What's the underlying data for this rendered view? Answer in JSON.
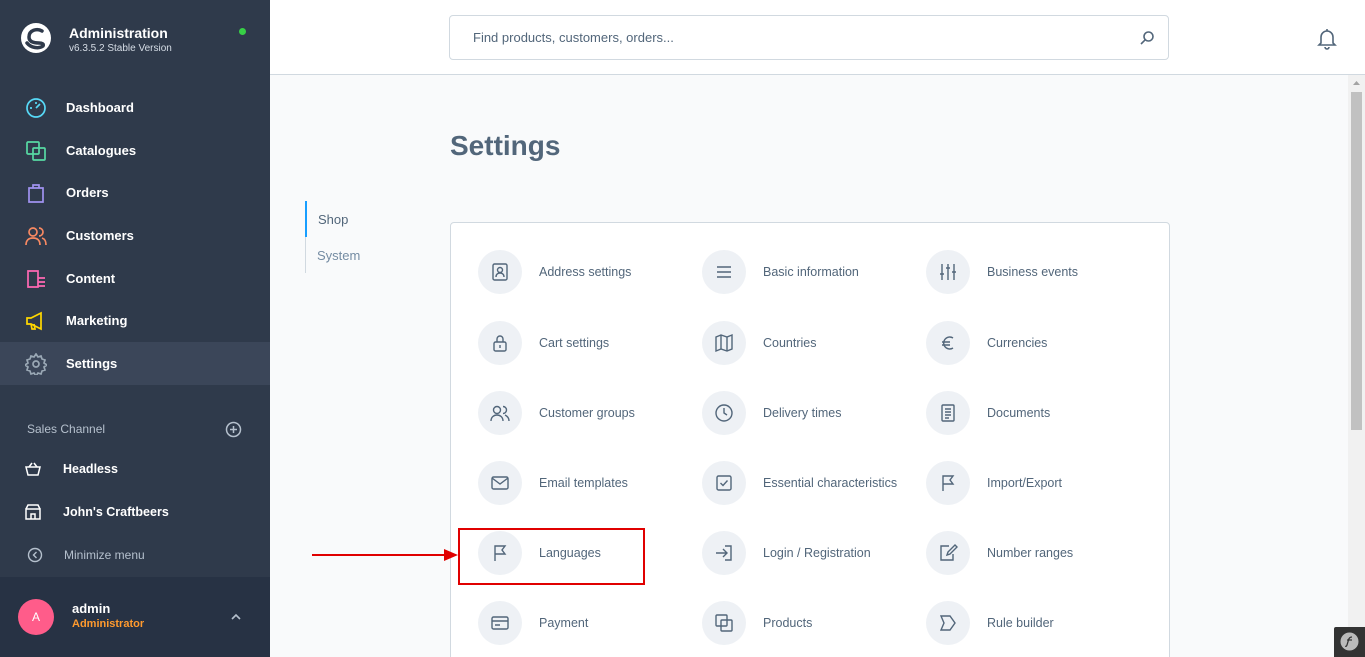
{
  "brand": {
    "title": "Administration",
    "version": "v6.3.5.2 Stable Version",
    "status_color": "#37d046"
  },
  "nav": [
    {
      "label": "Dashboard",
      "icon": "dashboard-icon",
      "color": "#57d9f7"
    },
    {
      "label": "Catalogues",
      "icon": "catalogues-icon",
      "color": "#57d9a3"
    },
    {
      "label": "Orders",
      "icon": "orders-icon",
      "color": "#a092f0"
    },
    {
      "label": "Customers",
      "icon": "customers-icon",
      "color": "#f88962"
    },
    {
      "label": "Content",
      "icon": "content-icon",
      "color": "#ff68b4"
    },
    {
      "label": "Marketing",
      "icon": "marketing-icon",
      "color": "#ffd700"
    },
    {
      "label": "Settings",
      "icon": "settings-icon",
      "color": "#9aa8b5",
      "active": true
    }
  ],
  "sales_channel": {
    "header": "Sales Channel",
    "items": [
      {
        "label": "Headless",
        "icon": "basket-icon"
      },
      {
        "label": "John's Craftbeers",
        "icon": "storefront-icon"
      }
    ]
  },
  "minimize_label": "Minimize menu",
  "user": {
    "initial": "A",
    "name": "admin",
    "role": "Administrator"
  },
  "search": {
    "placeholder": "Find products, customers, orders..."
  },
  "page": {
    "title": "Settings"
  },
  "tabs": [
    {
      "label": "Shop",
      "active": true
    },
    {
      "label": "System",
      "active": false
    }
  ],
  "settings": [
    {
      "label": "Address settings",
      "icon": "address-book-icon"
    },
    {
      "label": "Basic information",
      "icon": "list-icon"
    },
    {
      "label": "Business events",
      "icon": "sliders-icon"
    },
    {
      "label": "Cart settings",
      "icon": "lock-icon"
    },
    {
      "label": "Countries",
      "icon": "map-icon"
    },
    {
      "label": "Currencies",
      "icon": "euro-icon"
    },
    {
      "label": "Customer groups",
      "icon": "users-icon"
    },
    {
      "label": "Delivery times",
      "icon": "clock-icon"
    },
    {
      "label": "Documents",
      "icon": "document-icon"
    },
    {
      "label": "Email templates",
      "icon": "envelope-icon"
    },
    {
      "label": "Essential characteristics",
      "icon": "checkbox-icon"
    },
    {
      "label": "Import/Export",
      "icon": "flag-icon"
    },
    {
      "label": "Languages",
      "icon": "flag-icon"
    },
    {
      "label": "Login / Registration",
      "icon": "sign-in-icon"
    },
    {
      "label": "Number ranges",
      "icon": "edit-document-icon"
    },
    {
      "label": "Payment",
      "icon": "credit-card-icon"
    },
    {
      "label": "Products",
      "icon": "products-icon"
    },
    {
      "label": "Rule builder",
      "icon": "rule-icon"
    }
  ],
  "annotation": {
    "highlight_color": "#e00000"
  }
}
